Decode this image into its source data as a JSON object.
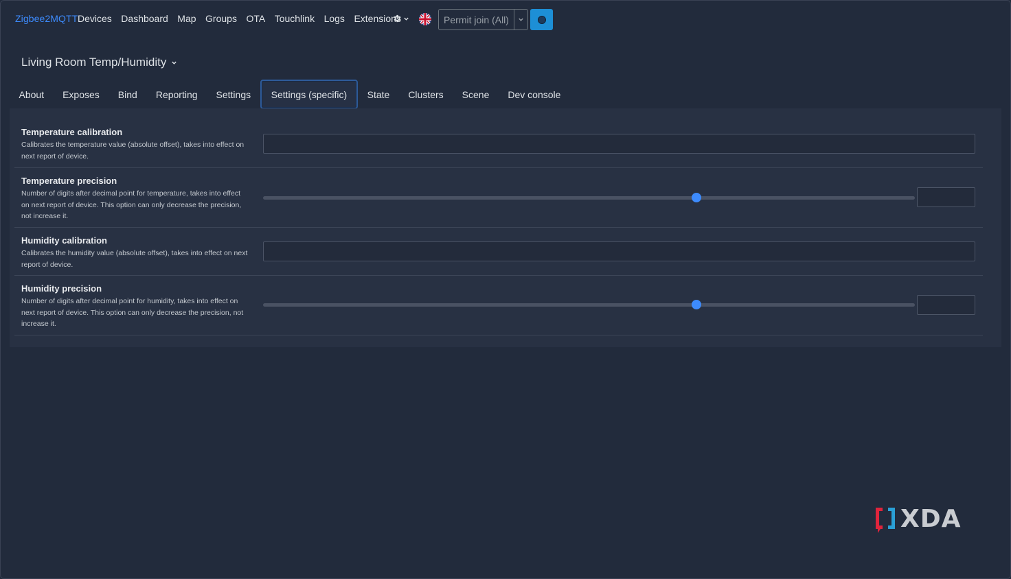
{
  "navbar": {
    "brand": "Zigbee2MQTT",
    "links": [
      "Devices",
      "Dashboard",
      "Map",
      "Groups",
      "OTA",
      "Touchlink",
      "Logs",
      "Extensions"
    ],
    "settings_icon": "gear-icon",
    "language_icon": "uk-flag-icon",
    "permit_join_label": "Permit join (All)",
    "status_icon": "circle-icon"
  },
  "device": {
    "title": "Living Room Temp/Humidity"
  },
  "tabs": [
    "About",
    "Exposes",
    "Bind",
    "Reporting",
    "Settings",
    "Settings (specific)",
    "State",
    "Clusters",
    "Scene",
    "Dev console"
  ],
  "active_tab": "Settings (specific)",
  "settings": [
    {
      "label": "Temperature calibration",
      "description": "Calibrates the temperature value (absolute offset), takes into effect on next report of device.",
      "control": "text",
      "value": ""
    },
    {
      "label": "Temperature precision",
      "description": "Number of digits after decimal point for temperature, takes into effect on next report of device. This option can only decrease the precision, not increase it.",
      "control": "slider",
      "slider_fraction": 0.665,
      "value": ""
    },
    {
      "label": "Humidity calibration",
      "description": "Calibrates the humidity value (absolute offset), takes into effect on next report of device.",
      "control": "text",
      "value": ""
    },
    {
      "label": "Humidity precision",
      "description": "Number of digits after decimal point for humidity, takes into effect on next report of device. This option can only decrease the precision, not increase it.",
      "control": "slider",
      "slider_fraction": 0.665,
      "value": ""
    }
  ],
  "watermark": {
    "text": "XDA",
    "bracket_color": "#e0243c",
    "bracket_color_2": "#2aa0d6"
  },
  "colors": {
    "background": "#222b3c",
    "panel": "#283143",
    "accent": "#3d8bfd",
    "status_button": "#1d8fd6"
  }
}
